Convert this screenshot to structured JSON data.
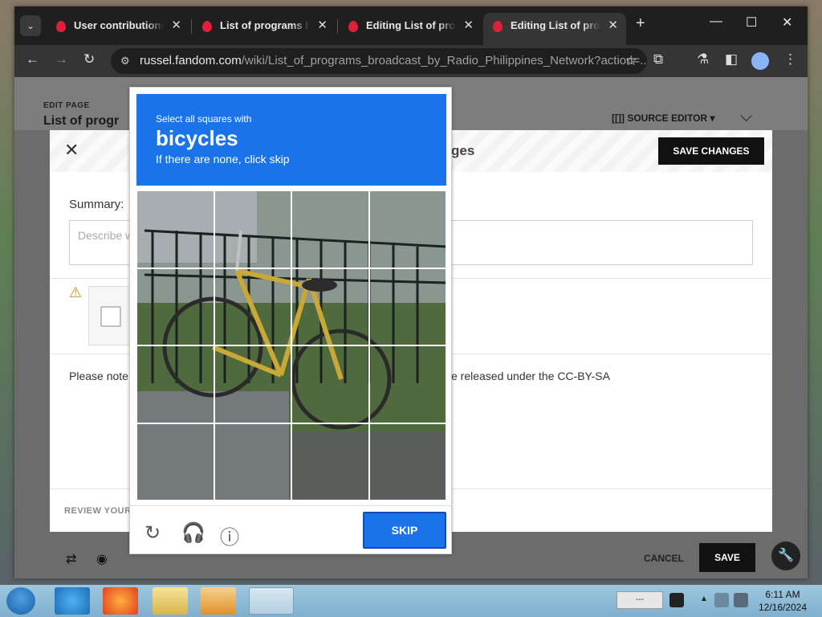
{
  "browser": {
    "tabs": [
      {
        "label": "User contributions fo",
        "active": false
      },
      {
        "label": "List of programs bro",
        "active": false
      },
      {
        "label": "Editing List of progr",
        "active": false
      },
      {
        "label": "Editing List of progr",
        "active": true
      }
    ],
    "url_host": "russel.fandom.com",
    "url_path": "/wiki/List_of_programs_broadcast_by_Radio_Philippines_Network?action=..."
  },
  "page": {
    "edit_label": "EDIT PAGE",
    "title": "List of progr",
    "source_editor": "[[]] SOURCE EDITOR ▾",
    "modal_title": "ges",
    "save_changes": "SAVE CHANGES",
    "summary_label": "Summary:",
    "summary_placeholder": "Describe w",
    "note_left": "Please note",
    "note_right": "e released under the CC-BY-SA",
    "review_label": "REVIEW YOUR",
    "cancel": "CANCEL",
    "save": "SAVE"
  },
  "captcha": {
    "instruction": "Select all squares with",
    "target": "bicycles",
    "subtext": "If there are none, click skip",
    "skip": "SKIP",
    "accent": "#1a73e8"
  },
  "taskbar": {
    "tray_label": "---",
    "time": "6:11 AM",
    "date": "12/16/2024"
  }
}
